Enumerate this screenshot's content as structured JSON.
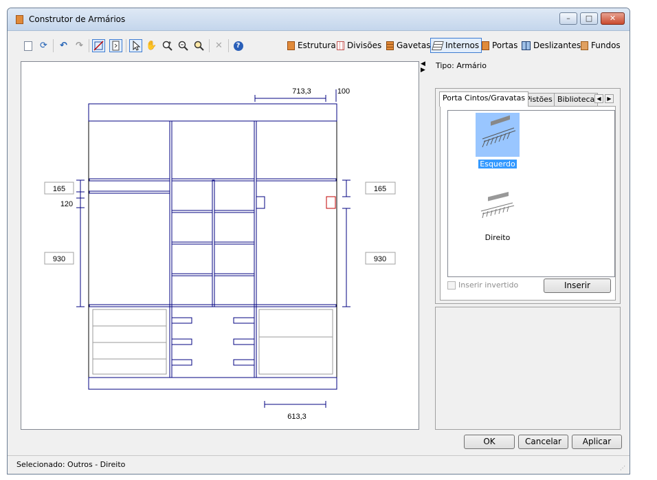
{
  "window": {
    "title": "Construtor de Armários"
  },
  "colors": {
    "drawing": "#000080",
    "accent": "#3d7bd1",
    "selection": "#3399ff",
    "highlight": "#c00000"
  },
  "toolbar": {
    "icons": [
      "new-icon",
      "refresh-icon",
      "undo-icon",
      "redo-icon",
      "no-dimensions-icon",
      "frame-icon",
      "pointer-icon",
      "pan-hand-icon",
      "zoom-in-icon",
      "zoom-out-icon",
      "zoom-fit-icon",
      "delete-icon",
      "help-icon"
    ],
    "tabs": [
      {
        "label": "Estrutura"
      },
      {
        "label": "Divisões"
      },
      {
        "label": "Gavetas"
      },
      {
        "label": "Internos",
        "active": true
      },
      {
        "label": "Portas"
      },
      {
        "label": "Deslizantes"
      },
      {
        "label": "Fundos"
      }
    ]
  },
  "drawing": {
    "dims": {
      "top_width": "713,3",
      "top_offset": "100",
      "bottom_width": "613,3",
      "left_upper": "165",
      "left_middle": "120",
      "left_lower": "930",
      "right_upper": "165",
      "right_lower": "930"
    }
  },
  "side": {
    "tipo": "Tipo: Armário",
    "tabs": [
      "Porta Cintos/Gravatas",
      "Pistões",
      "Biblioteca"
    ],
    "items": [
      {
        "label": "Esquerdo",
        "selected": true
      },
      {
        "label": "Direito",
        "selected": false
      }
    ],
    "checkbox": "Inserir invertido",
    "insert_button": "Inserir"
  },
  "buttons": {
    "ok": "OK",
    "cancel": "Cancelar",
    "apply": "Aplicar"
  },
  "status": {
    "text": "Selecionado: Outros - Direito"
  }
}
